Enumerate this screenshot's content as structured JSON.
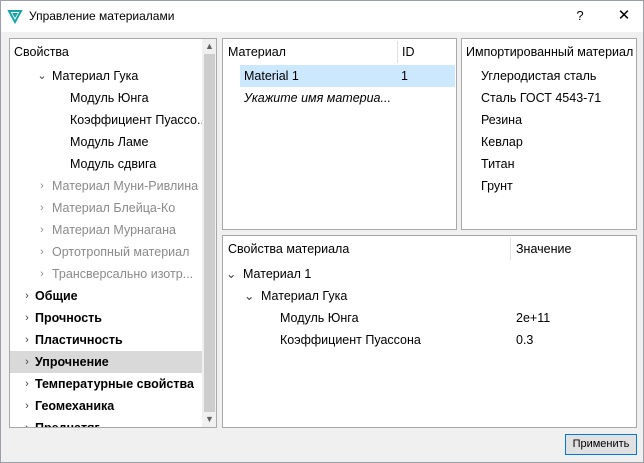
{
  "window": {
    "title": "Управление материалами",
    "help": "?",
    "close": "✕"
  },
  "tree": {
    "header": "Свойства",
    "rows": [
      {
        "label": "Материал Гука",
        "arrow": "⌄",
        "level": 1,
        "style": "normal"
      },
      {
        "label": "Модуль Юнга",
        "arrow": "",
        "level": 2,
        "style": "normal"
      },
      {
        "label": "Коэффициент Пуассо...",
        "arrow": "",
        "level": 2,
        "style": "normal"
      },
      {
        "label": "Модуль Ламе",
        "arrow": "",
        "level": 2,
        "style": "normal"
      },
      {
        "label": "Модуль сдвига",
        "arrow": "",
        "level": 2,
        "style": "normal"
      },
      {
        "label": "Материал Муни-Ривлина",
        "arrow": "›",
        "level": 1,
        "style": "grey"
      },
      {
        "label": "Материал Блейца-Ко",
        "arrow": "›",
        "level": 1,
        "style": "grey"
      },
      {
        "label": "Материал Мурнагана",
        "arrow": "›",
        "level": 1,
        "style": "grey"
      },
      {
        "label": "Ортотропный материал",
        "arrow": "›",
        "level": 1,
        "style": "grey"
      },
      {
        "label": "Трансверсально изотр...",
        "arrow": "›",
        "level": 1,
        "style": "grey"
      },
      {
        "label": "Общие",
        "arrow": "›",
        "level": 0,
        "style": "bold"
      },
      {
        "label": "Прочность",
        "arrow": "›",
        "level": 0,
        "style": "bold"
      },
      {
        "label": "Пластичность",
        "arrow": "›",
        "level": 0,
        "style": "bold"
      },
      {
        "label": "Упрочнение",
        "arrow": "›",
        "level": 0,
        "style": "bold",
        "selected": true
      },
      {
        "label": "Температурные свойства",
        "arrow": "›",
        "level": 0,
        "style": "bold"
      },
      {
        "label": "Геомеханика",
        "arrow": "›",
        "level": 0,
        "style": "bold"
      },
      {
        "label": "Преднатяг",
        "arrow": "›",
        "level": 0,
        "style": "bold"
      }
    ]
  },
  "materials": {
    "col_material": "Материал",
    "col_id": "ID",
    "rows": [
      {
        "name": "Material 1",
        "id": "1",
        "selected": true
      },
      {
        "name": "Укажите имя материа...",
        "id": "",
        "italic": true
      }
    ]
  },
  "imported": {
    "header": "Импортированный материал",
    "items": [
      "Углеродистая сталь",
      "Сталь ГОСТ 4543-71",
      "Резина",
      "Кевлар",
      "Титан",
      "Грунт"
    ]
  },
  "properties": {
    "col_prop": "Свойства материала",
    "col_value": "Значение",
    "rows": [
      {
        "label": "Материал 1",
        "value": "",
        "level": 0,
        "arrow": "⌄"
      },
      {
        "label": "Материал Гука",
        "value": "",
        "level": 1,
        "arrow": "⌄"
      },
      {
        "label": "Модуль Юнга",
        "value": "2e+11",
        "level": 2,
        "arrow": ""
      },
      {
        "label": "Коэффициент Пуассона",
        "value": "0.3",
        "level": 2,
        "arrow": ""
      }
    ]
  },
  "buttons": {
    "apply": "Применить"
  },
  "colors": {
    "selection_blue": "#cce8ff",
    "selection_grey": "#d9d9d9",
    "accent": "#0078d7",
    "icon_teal": "#1aa2a8"
  }
}
